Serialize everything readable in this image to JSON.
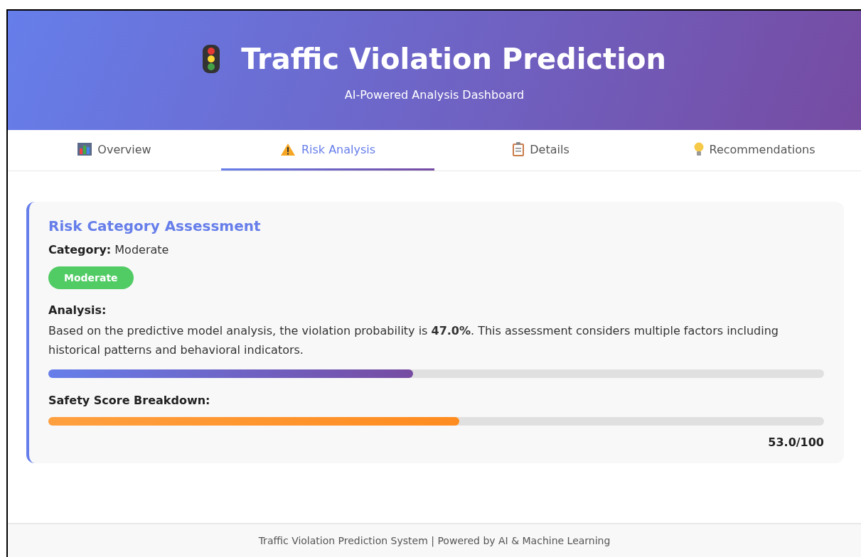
{
  "header": {
    "title": "Traffic Violation Prediction",
    "subtitle": "AI-Powered Analysis Dashboard"
  },
  "tabs": [
    {
      "label": "Overview",
      "selected": false
    },
    {
      "label": "Risk Analysis",
      "selected": true
    },
    {
      "label": "Details",
      "selected": false
    },
    {
      "label": "Recommendations",
      "selected": false
    }
  ],
  "card": {
    "title": "Risk Category Assessment",
    "category_label": "Category:",
    "category_value": "Moderate",
    "badge": {
      "label": "Moderate",
      "color": "#51cb64"
    },
    "analysis_heading": "Analysis:",
    "analysis_text": "Based on the predictive model analysis, the violation probability is **47.0%**. This assessment considers multiple factors including historical patterns and behavioral indicators.",
    "probability": {
      "level": 0.47
    },
    "safety_heading": "Safety Score Breakdown:",
    "safety": {
      "level": 0.53
    },
    "safety_reading": "53.0/100"
  },
  "footer": "Traffic Violation Prediction System | Powered by AI & Machine Learning"
}
